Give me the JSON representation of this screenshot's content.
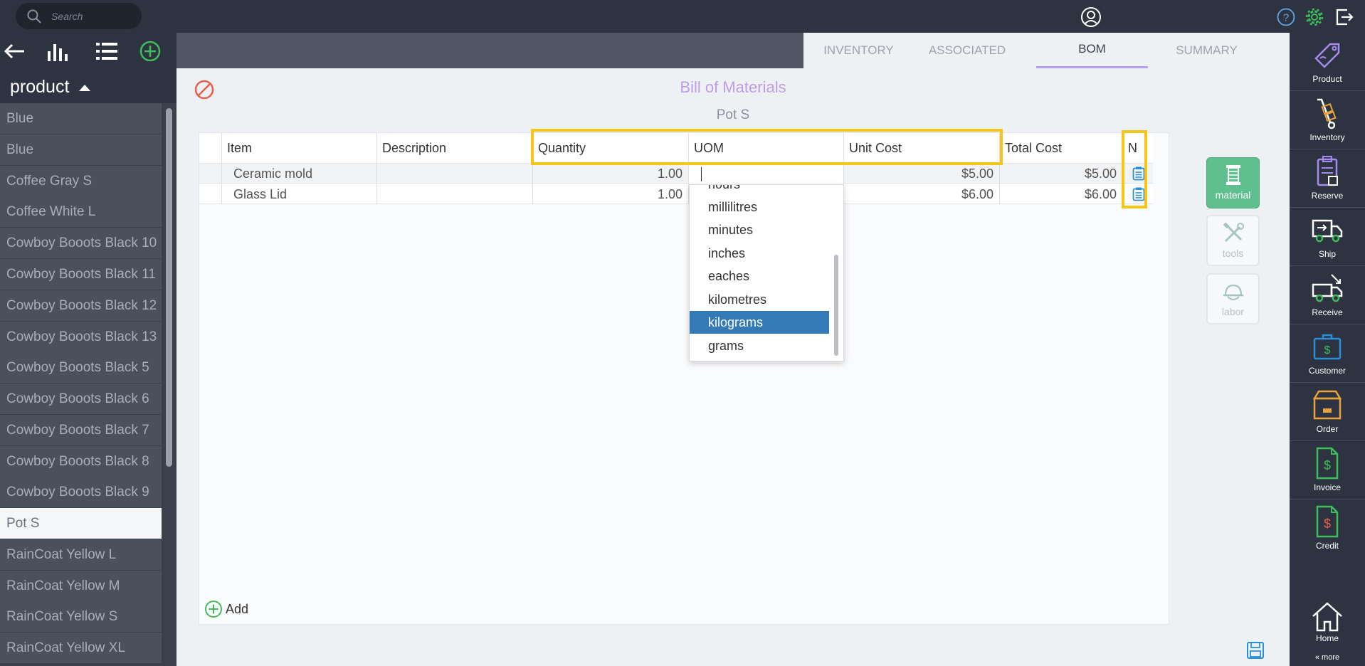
{
  "search": {
    "placeholder": "Search"
  },
  "left_panel": {
    "header": "product",
    "items": [
      {
        "label": "Blue",
        "selected": false
      },
      {
        "label": "Blue",
        "selected": false
      },
      {
        "label": "Coffee Gray S",
        "selected": false
      },
      {
        "label": "Coffee White L",
        "selected": false
      },
      {
        "label": "Cowboy Booots Black 10",
        "selected": false
      },
      {
        "label": "Cowboy Booots Black 11",
        "selected": false
      },
      {
        "label": "Cowboy Booots Black 12",
        "selected": false
      },
      {
        "label": "Cowboy Booots Black 13",
        "selected": false
      },
      {
        "label": "Cowboy Booots Black 5",
        "selected": false
      },
      {
        "label": "Cowboy Booots Black 6",
        "selected": false
      },
      {
        "label": "Cowboy Booots Black 7",
        "selected": false
      },
      {
        "label": "Cowboy Booots Black 8",
        "selected": false
      },
      {
        "label": "Cowboy Booots Black 9",
        "selected": false
      },
      {
        "label": "Pot S",
        "selected": true
      },
      {
        "label": "RainCoat Yellow L",
        "selected": false
      },
      {
        "label": "RainCoat Yellow M",
        "selected": false
      },
      {
        "label": "RainCoat Yellow S",
        "selected": false
      },
      {
        "label": "RainCoat Yellow XL",
        "selected": false
      }
    ]
  },
  "tabs": [
    {
      "label": "INVENTORY",
      "active": false
    },
    {
      "label": "ASSOCIATED",
      "active": false
    },
    {
      "label": "BOM",
      "active": true
    },
    {
      "label": "SUMMARY",
      "active": false
    }
  ],
  "main": {
    "title": "Bill of Materials",
    "subtitle": "Pot S",
    "columns": [
      "Item",
      "Description",
      "Quantity",
      "UOM",
      "Unit Cost",
      "Total Cost",
      "N"
    ],
    "rows": [
      {
        "item": "Ceramic mold",
        "description": "",
        "quantity": "1.00",
        "uom": "",
        "unit_cost": "$5.00",
        "total_cost": "$5.00"
      },
      {
        "item": "Glass Lid",
        "description": "",
        "quantity": "1.00",
        "uom": "",
        "unit_cost": "$6.00",
        "total_cost": "$6.00"
      }
    ],
    "add_label": "Add",
    "uom_dropdown": {
      "options": [
        "hours",
        "millilitres",
        "minutes",
        "inches",
        "eaches",
        "kilometres",
        "kilograms",
        "grams"
      ],
      "selected": "kilograms"
    },
    "actions": [
      {
        "label": "material",
        "active": true
      },
      {
        "label": "tools",
        "active": false
      },
      {
        "label": "labor",
        "active": false
      }
    ]
  },
  "right_sidebar": {
    "items": [
      "Product",
      "Inventory",
      "Reserve",
      "Ship",
      "Receive",
      "Customer",
      "Order",
      "Invoice",
      "Credit"
    ],
    "home": "Home",
    "more": "« more"
  },
  "colors": {
    "dark_bg": "#2d3340",
    "accent_purple": "#b59ff2",
    "highlight": "#f5c518",
    "selected_option": "#337ab7",
    "material_green": "#5fbf8f"
  }
}
